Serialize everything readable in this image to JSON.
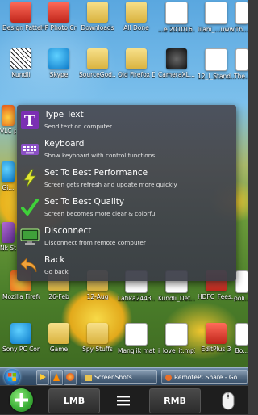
{
  "desktop": {
    "row1": [
      "Design Patterns(J...",
      "HP Photo Creations",
      "Downloads",
      "All Done",
      "...e 201016...",
      "lilahi_...uww...",
      "Th..."
    ],
    "row2": [
      "Kundli",
      "Skype",
      "SourceGod...",
      "Old Firefox Data",
      "CameraXL...",
      "12_I_Stand...",
      "The..."
    ],
    "row3": [
      "Mozilla Firefox",
      "26-Feb",
      "12-Aug",
      "Latika2443...",
      "Kundli_Det...",
      "HDFC_Fees...",
      "poli..."
    ],
    "row4": [
      "Sony PC Compani...",
      "Game",
      "Spy Stuffs",
      "Manglik matrymone...",
      "i_love_it.mp3",
      "EditPlus 3",
      "Bo..."
    ],
    "left_partial": [
      "VLC pl...",
      "Gi...",
      "Nk Stam..."
    ]
  },
  "menu": {
    "items": [
      {
        "title": "Type Text",
        "subtitle": "Send text on computer",
        "icon": "type-text-icon"
      },
      {
        "title": "Keyboard",
        "subtitle": "Show keyboard with control functions",
        "icon": "keyboard-icon"
      },
      {
        "title": "Set To Best Performance",
        "subtitle": "Screen gets refresh and update more quickly",
        "icon": "lightning-icon"
      },
      {
        "title": "Set To Best Quality",
        "subtitle": "Screen becomes more clear & colorful",
        "icon": "checkmark-icon"
      },
      {
        "title": "Disconnect",
        "subtitle": "Disconnect from remote computer",
        "icon": "monitor-icon"
      },
      {
        "title": "Back",
        "subtitle": "Go back",
        "icon": "back-arrow-icon"
      }
    ]
  },
  "taskbar": {
    "screenshots_label": "ScreenShots",
    "remote_label": "RemotePCShare - Go..."
  },
  "bottombar": {
    "lmb_label": "LMB",
    "rmb_label": "RMB"
  },
  "colors": {
    "menu_bg": "#484a54",
    "accent_green": "#3fb23a",
    "taskbar": "#3b5570"
  }
}
